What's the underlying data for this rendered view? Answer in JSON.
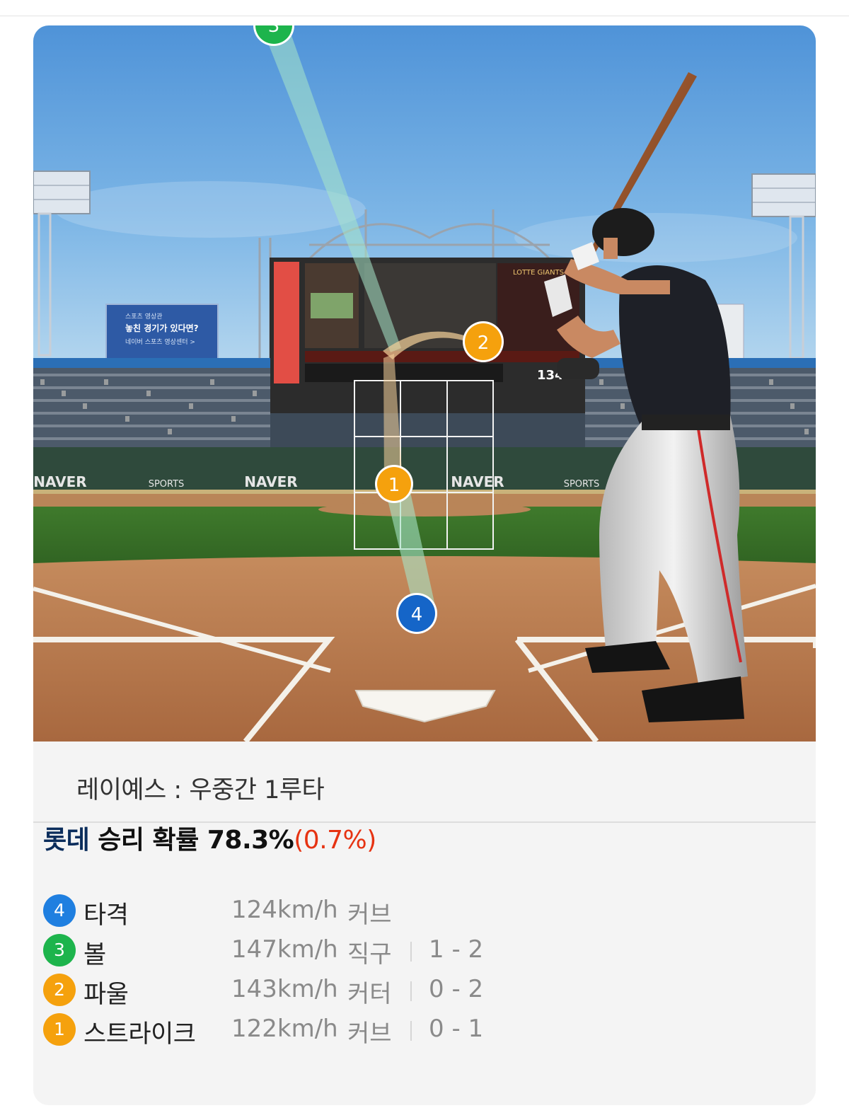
{
  "scene": {
    "left_board": {
      "line1": "스포츠 영상관",
      "line2": "놓친 경기가 있다면?",
      "line3": "네이버 스포츠 영상센터 >"
    },
    "sponsor_main": "NAVER",
    "sponsor_sub": "SPORTS",
    "scoreboard_team": "LOTTE GIANTS",
    "scoreboard_speed": "134",
    "markers": [
      {
        "num": "1",
        "color": "#f5a10d"
      },
      {
        "num": "2",
        "color": "#f5a10d"
      },
      {
        "num": "3",
        "color": "#1db44c"
      },
      {
        "num": "4",
        "color": "#1565c8"
      }
    ]
  },
  "play": {
    "text": "레이예스 : 우중간 1루타"
  },
  "win_prob": {
    "team": "롯데",
    "label": " 승리 확률 ",
    "value": "78.3%",
    "delta": "(0.7%)"
  },
  "pitches": [
    {
      "num": "4",
      "color": "#1f7fe0",
      "result": "타격",
      "speed": "124km/h",
      "type": "커브",
      "count": ""
    },
    {
      "num": "3",
      "color": "#1db44c",
      "result": "볼",
      "speed": "147km/h",
      "type": "직구",
      "count": "1 - 2"
    },
    {
      "num": "2",
      "color": "#f5a10d",
      "result": "파울",
      "speed": "143km/h",
      "type": "커터",
      "count": "0 - 2"
    },
    {
      "num": "1",
      "color": "#f5a10d",
      "result": "스트라이크",
      "speed": "122km/h",
      "type": "커브",
      "count": "0 - 1"
    }
  ]
}
